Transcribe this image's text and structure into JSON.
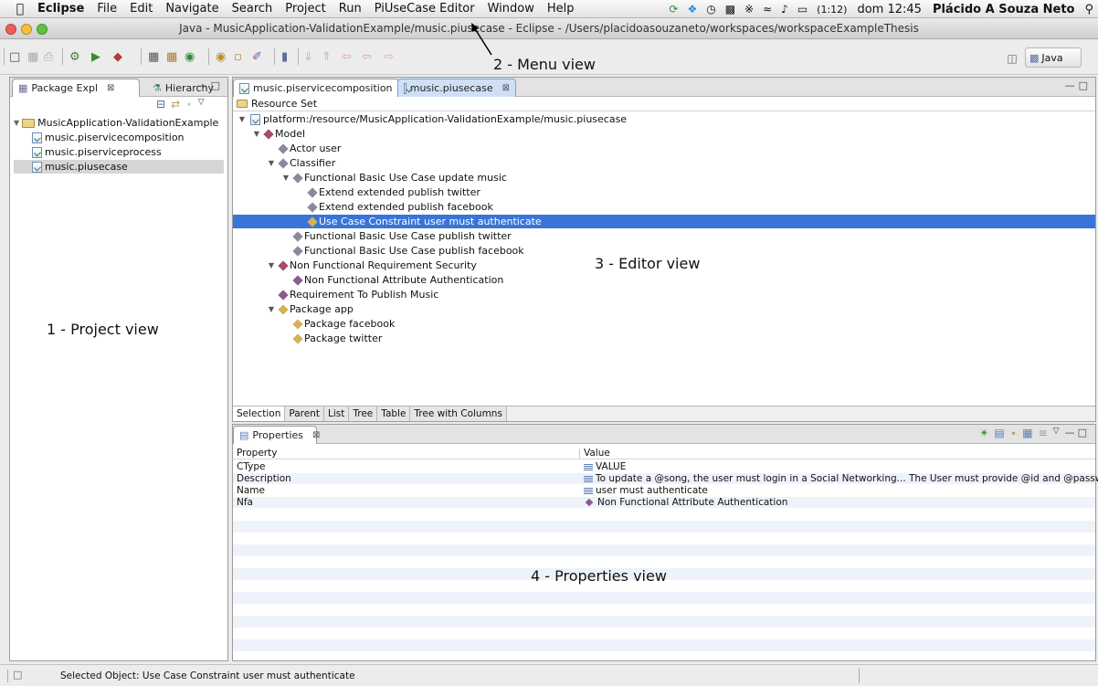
{
  "menubar": {
    "apple_icon": "apple-logo-icon",
    "app_name": "Eclipse",
    "items": [
      "File",
      "Edit",
      "Navigate",
      "Search",
      "Project",
      "Run",
      "PiUseCase Editor",
      "Window",
      "Help"
    ],
    "battery_text": "(1:12)",
    "clock": "dom 12:45",
    "user": "Plácido A Souza Neto"
  },
  "window": {
    "title": "Java - MusicApplication-ValidationExample/music.piusecase - Eclipse - /Users/placidoasouzaneto/workspaces/workspaceExampleThesis"
  },
  "toolbar": {
    "perspective_label": "Java"
  },
  "annotations": {
    "menu_view": "2 - Menu view",
    "project_view": "1 - Project view",
    "editor_view": "3 - Editor view",
    "properties_view": "4 - Properties view"
  },
  "left_panel": {
    "tabs": [
      "Package Expl",
      "Hierarchy"
    ],
    "tree": [
      {
        "label": "MusicApplication-ValidationExample",
        "type": "project"
      },
      {
        "label": "music.piservicecomposition",
        "type": "file"
      },
      {
        "label": "music.piserviceprocess",
        "type": "file"
      },
      {
        "label": "music.piusecase",
        "type": "file",
        "selected": true
      }
    ]
  },
  "editor": {
    "tabs": [
      "music.piservicecomposition",
      "music.piusecase"
    ],
    "active_tab": "music.piusecase",
    "header": "Resource Set",
    "tree": [
      {
        "label": "platform:/resource/MusicApplication-ValidationExample/music.piusecase",
        "icon": "file"
      },
      {
        "label": "Model",
        "icon": "red"
      },
      {
        "label": "Actor user",
        "icon": "grey"
      },
      {
        "label": "Classifier",
        "icon": "grey"
      },
      {
        "label": "Functional Basic Use Case update music",
        "icon": "grey"
      },
      {
        "label": "Extend extended publish twitter",
        "icon": "grey"
      },
      {
        "label": "Extend extended publish facebook",
        "icon": "grey"
      },
      {
        "label": "Use Case Constraint user must authenticate",
        "icon": "yellow",
        "selected": true
      },
      {
        "label": "Functional Basic Use Case publish twitter",
        "icon": "grey"
      },
      {
        "label": "Functional Basic Use Case publish facebook",
        "icon": "grey"
      },
      {
        "label": "Non Functional Requirement Security",
        "icon": "red"
      },
      {
        "label": "Non Functional Attribute Authentication",
        "icon": "purple"
      },
      {
        "label": "Requirement To Publish Music",
        "icon": "purple"
      },
      {
        "label": "Package app",
        "icon": "yellow"
      },
      {
        "label": "Package facebook",
        "icon": "yellow"
      },
      {
        "label": "Package twitter",
        "icon": "yellow"
      }
    ],
    "bottom_tabs": [
      "Selection",
      "Parent",
      "List",
      "Tree",
      "Table",
      "Tree with Columns"
    ]
  },
  "properties": {
    "tab": "Properties",
    "columns": [
      "Property",
      "Value"
    ],
    "rows": [
      {
        "key": "CType",
        "value": "VALUE"
      },
      {
        "key": "Description",
        "value": "To update a @song, the user must login in a Social Networking...  The User must provide @id and @passworc"
      },
      {
        "key": "Name",
        "value": "user must authenticate"
      },
      {
        "key": "Nfa",
        "value": "Non Functional Attribute Authentication"
      }
    ]
  },
  "statusbar": {
    "text": "Selected Object: Use Case Constraint user must authenticate"
  }
}
